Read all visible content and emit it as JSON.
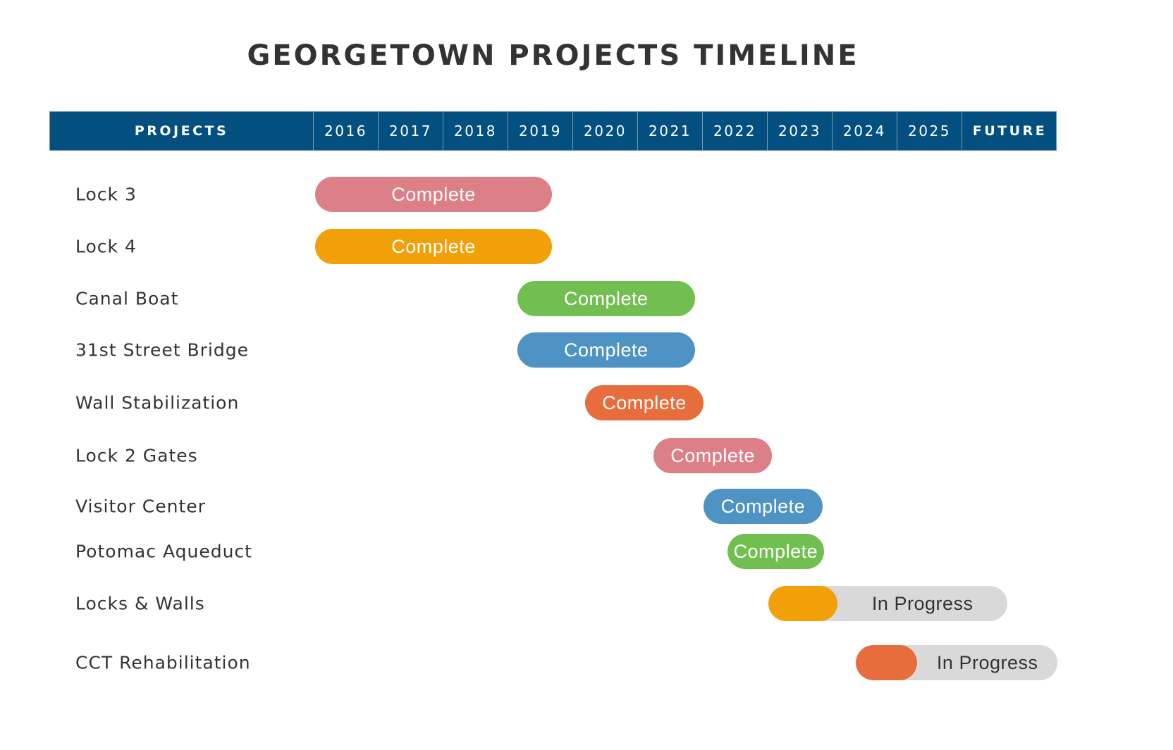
{
  "chart_data": {
    "type": "gantt",
    "title": "GEORGETOWN PROJECTS TIMELINE",
    "header": {
      "first_column_label": "PROJECTS",
      "columns": [
        "2016",
        "2017",
        "2018",
        "2019",
        "2020",
        "2021",
        "2022",
        "2023",
        "2024",
        "2025",
        "FUTURE"
      ]
    },
    "x_axis": {
      "start": 2016,
      "end": 2027,
      "unit": "year"
    },
    "colors": {
      "header_bg": "#024f80",
      "pink": "#dc7f86",
      "orange": "#f2a007",
      "green": "#72bf51",
      "blue": "#4e93c3",
      "red_orange": "#e86d3c",
      "track_gray": "#d9d9d9",
      "complete_text": "#ffffff",
      "progress_text": "#333333"
    },
    "tasks": [
      {
        "name": "Lock 3",
        "start": 2016.04,
        "end": 2019.7,
        "status": "Complete",
        "color": "#dc7f86"
      },
      {
        "name": "Lock 4",
        "start": 2016.04,
        "end": 2019.7,
        "status": "Complete",
        "color": "#f2a007"
      },
      {
        "name": "Canal Boat",
        "start": 2019.16,
        "end": 2021.9,
        "status": "Complete",
        "color": "#72bf51"
      },
      {
        "name": "31st Street Bridge",
        "start": 2019.16,
        "end": 2021.9,
        "status": "Complete",
        "color": "#4e93c3"
      },
      {
        "name": "Wall Stabilization",
        "start": 2020.21,
        "end": 2022.03,
        "status": "Complete",
        "color": "#e86d3c"
      },
      {
        "name": "Lock 2 Gates",
        "start": 2021.26,
        "end": 2023.09,
        "status": "Complete",
        "color": "#dc7f86"
      },
      {
        "name": "Visitor Center",
        "start": 2022.03,
        "end": 2023.87,
        "status": "Complete",
        "color": "#4e93c3"
      },
      {
        "name": "Potomac Aqueduct",
        "start": 2022.4,
        "end": 2023.89,
        "status": "Complete",
        "color": "#72bf51"
      },
      {
        "name": "Locks & Walls",
        "start": 2023.03,
        "end": 2026.72,
        "progress_end": 2024.1,
        "status": "In Progress",
        "color": "#f2a007"
      },
      {
        "name": "CCT Rehabilitation",
        "start": 2024.38,
        "end": 2027.49,
        "progress_end": 2025.33,
        "status": "In Progress",
        "color": "#e86d3c"
      }
    ]
  }
}
